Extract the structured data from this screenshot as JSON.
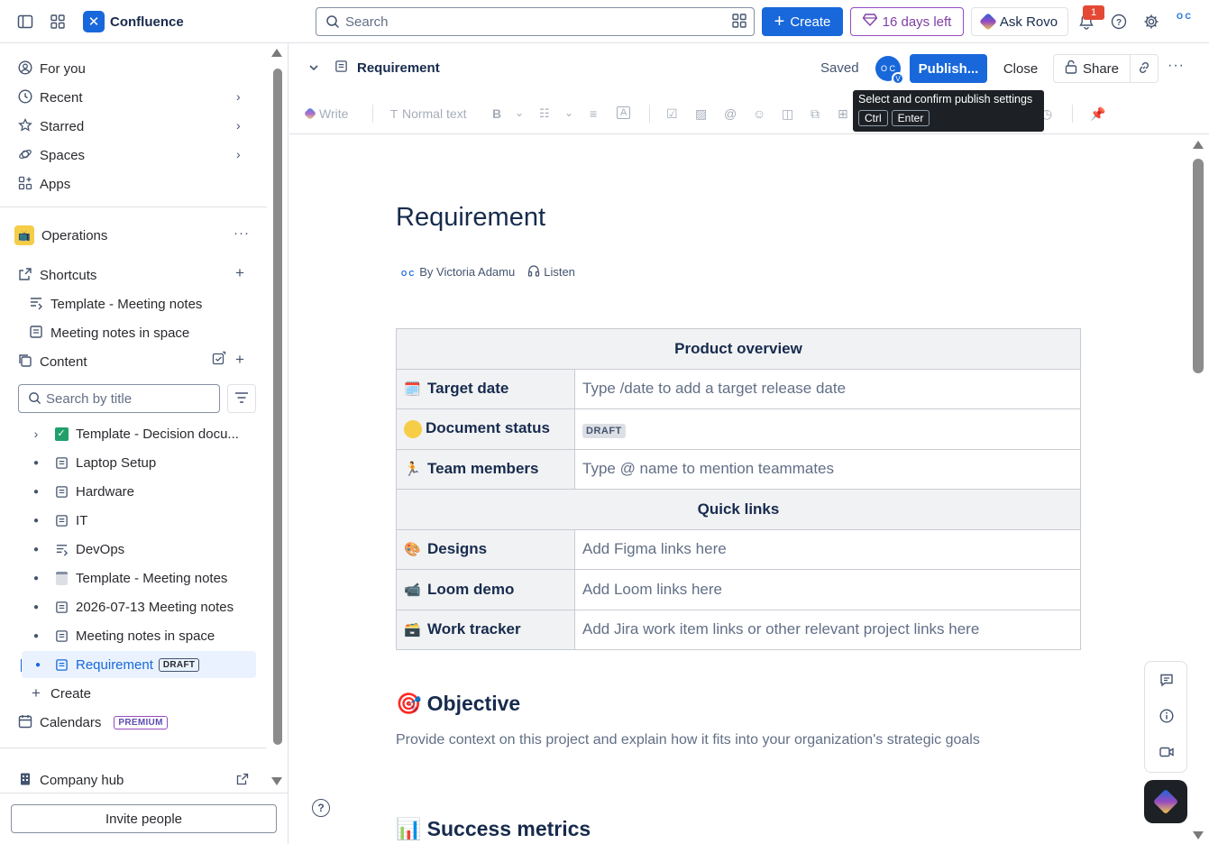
{
  "topbar": {
    "app_name": "Confluence",
    "search_placeholder": "Search",
    "create_label": "Create",
    "trial_label": "16 days left",
    "rovo_label": "Ask Rovo",
    "notification_count": "1",
    "avatar_initials": "O C"
  },
  "sidebar": {
    "nav": [
      {
        "label": "For you"
      },
      {
        "label": "Recent"
      },
      {
        "label": "Starred"
      },
      {
        "label": "Spaces"
      },
      {
        "label": "Apps"
      }
    ],
    "space_name": "Operations",
    "shortcuts_label": "Shortcuts",
    "shortcuts": [
      {
        "label": "Template - Meeting notes"
      },
      {
        "label": "Meeting notes in space"
      }
    ],
    "content_label": "Content",
    "search_title_placeholder": "Search by title",
    "tree": [
      {
        "label": "Template - Decision docu..."
      },
      {
        "label": "Laptop Setup"
      },
      {
        "label": "Hardware"
      },
      {
        "label": "IT"
      },
      {
        "label": "DevOps"
      },
      {
        "label": "Template - Meeting notes"
      },
      {
        "label": "2026-07-13 Meeting notes"
      },
      {
        "label": "Meeting notes in space"
      },
      {
        "label": "Requirement",
        "badge": "DRAFT"
      }
    ],
    "create_label": "Create",
    "calendars_label": "Calendars",
    "calendars_badge": "PREMIUM",
    "company_hub_label": "Company hub",
    "invite_label": "Invite people"
  },
  "page_header": {
    "title": "Requirement",
    "saved_label": "Saved",
    "collaborator_initials": "O C",
    "collaborator_badge": "V",
    "publish_label": "Publish...",
    "close_label": "Close",
    "share_label": "Share"
  },
  "toolbar": {
    "write_label": "Write",
    "text_style_label": "Normal text",
    "bold_label": "B"
  },
  "tooltip": {
    "text": "Select and confirm publish settings",
    "key1": "Ctrl",
    "key2": "Enter"
  },
  "document": {
    "title": "Requirement",
    "author_initials": "O C",
    "byline": "By Victoria Adamu",
    "listen_label": "Listen",
    "table": {
      "header1": "Product overview",
      "rows1": [
        {
          "emoji": "🗓️",
          "key": "Target date",
          "value": "Type /date to add a target release date"
        },
        {
          "key": "Document status",
          "value": "DRAFT"
        },
        {
          "emoji": "🏃",
          "key": "Team members",
          "value": "Type @ name to mention teammates"
        }
      ],
      "header2": "Quick links",
      "rows2": [
        {
          "emoji": "🎨",
          "key": "Designs",
          "value": "Add Figma links here"
        },
        {
          "emoji": "📹",
          "key": "Loom demo",
          "value": "Add Loom links here"
        },
        {
          "emoji": "🗃️",
          "key": "Work tracker",
          "value": "Add Jira work item links or other relevant project links here"
        }
      ]
    },
    "objective_emoji": "🎯",
    "objective_heading": "Objective",
    "objective_text": "Provide context on this project and explain how it fits into your organization's strategic goals",
    "success_emoji": "📊",
    "success_heading": "Success metrics"
  },
  "colors": {
    "brand_blue": "#1868db",
    "trial_purple": "#803fa5",
    "notification_red": "#e34935"
  }
}
